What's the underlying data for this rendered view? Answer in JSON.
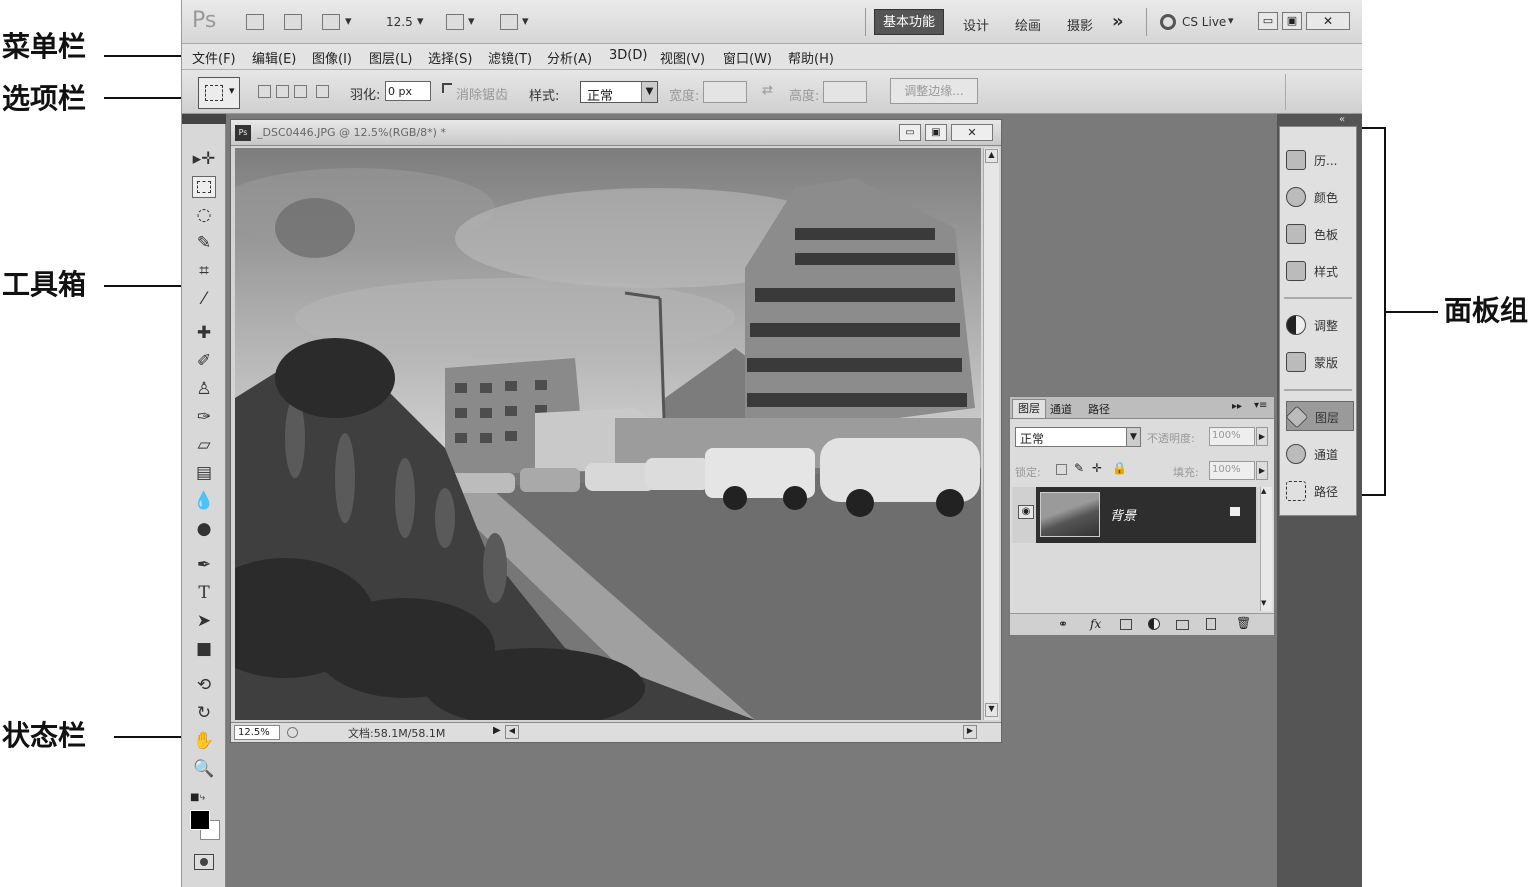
{
  "callouts": {
    "menubar": "菜单栏",
    "optionsbar": "选项栏",
    "toolbox": "工具箱",
    "statusbar": "状态栏",
    "panels": "面板组"
  },
  "appbar": {
    "logo": "Ps",
    "zoom": "12.5",
    "workspaces": [
      "基本功能",
      "设计",
      "绘画",
      "摄影"
    ],
    "more": "»",
    "cslive": "CS Live"
  },
  "menu": [
    "文件(F)",
    "编辑(E)",
    "图像(I)",
    "图层(L)",
    "选择(S)",
    "滤镜(T)",
    "分析(A)",
    "3D(D)",
    "视图(V)",
    "窗口(W)",
    "帮助(H)"
  ],
  "options": {
    "feather_label": "羽化:",
    "feather_value": "0 px",
    "antialias_label": "消除锯齿",
    "style_label": "样式:",
    "style_value": "正常",
    "width_label": "宽度:",
    "height_label": "高度:",
    "refine_button": "调整边缘..."
  },
  "document": {
    "title": "_DSC0446.JPG @ 12.5%(RGB/8*) *",
    "zoom": "12.5%",
    "doc_info": "文档:58.1M/58.1M"
  },
  "panel_icons": [
    {
      "icon": "history-icon",
      "label": "历..."
    },
    {
      "icon": "color-icon",
      "label": "颜色"
    },
    {
      "icon": "swatches-icon",
      "label": "色板"
    },
    {
      "icon": "styles-icon",
      "label": "样式"
    },
    {
      "icon": "adjustments-icon",
      "label": "调整"
    },
    {
      "icon": "masks-icon",
      "label": "蒙版"
    },
    {
      "icon": "layers-icon",
      "label": "图层"
    },
    {
      "icon": "channels-icon",
      "label": "通道"
    },
    {
      "icon": "paths-icon",
      "label": "路径"
    }
  ],
  "layers_panel": {
    "tabs": [
      "图层",
      "通道",
      "路径"
    ],
    "blend_mode": "正常",
    "opacity_label": "不透明度:",
    "opacity_value": "100%",
    "lock_label": "锁定:",
    "fill_label": "填充:",
    "fill_value": "100%",
    "layer_name": "背景"
  }
}
